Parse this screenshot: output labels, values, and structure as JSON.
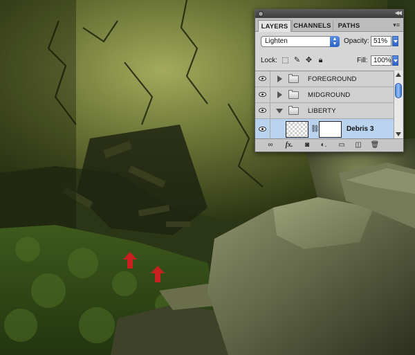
{
  "panel": {
    "tabs": [
      {
        "label": "LAYERS",
        "active": true
      },
      {
        "label": "CHANNELS",
        "active": false
      },
      {
        "label": "PATHS",
        "active": false
      }
    ],
    "blend_mode": "Lighten",
    "opacity_label": "Opacity:",
    "opacity_value": "51%",
    "lock_label": "Lock:",
    "fill_label": "Fill:",
    "fill_value": "100%",
    "layers": [
      {
        "name": "FOREGROUND",
        "type": "group",
        "expanded": false,
        "visible": true
      },
      {
        "name": "MIDGROUND",
        "type": "group",
        "expanded": false,
        "visible": true
      },
      {
        "name": "LIBERTY",
        "type": "group",
        "expanded": true,
        "visible": true
      },
      {
        "name": "Debris 3",
        "type": "layer",
        "selected": true,
        "visible": true,
        "has_mask": true
      }
    ],
    "footer_icons": [
      "link-layers",
      "fx",
      "add-mask",
      "adjustment-layer",
      "new-group",
      "new-layer",
      "delete-layer"
    ]
  },
  "colors": {
    "accent_blue": "#2a62c9",
    "selected_row": "#b9d2ee",
    "arrow_red": "#c8201e"
  }
}
